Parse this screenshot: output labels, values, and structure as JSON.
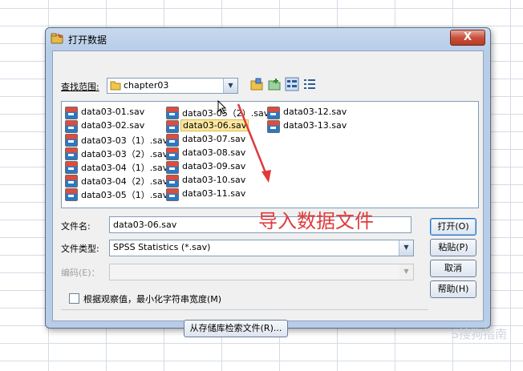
{
  "dialog": {
    "title": "打开数据",
    "close_label": "X",
    "look_in_label": "查找范围:",
    "look_in_value": "chapter03",
    "files": [
      {
        "name": "data03-01.sav",
        "selected": false
      },
      {
        "name": "data03-02.sav",
        "selected": false
      },
      {
        "name": "data03-03（1）.sav",
        "selected": false
      },
      {
        "name": "data03-03（2）.sav",
        "selected": false
      },
      {
        "name": "data03-04（1）.sav",
        "selected": false
      },
      {
        "name": "data03-04（2）.sav",
        "selected": false
      },
      {
        "name": "data03-05（1）.sav",
        "selected": false
      },
      {
        "name": "data03-05（2）.sav",
        "selected": false
      },
      {
        "name": "data03-06.sav",
        "selected": true
      },
      {
        "name": "data03-07.sav",
        "selected": false
      },
      {
        "name": "data03-08.sav",
        "selected": false
      },
      {
        "name": "data03-09.sav",
        "selected": false
      },
      {
        "name": "data03-10.sav",
        "selected": false
      },
      {
        "name": "data03-11.sav",
        "selected": false
      },
      {
        "name": "data03-12.sav",
        "selected": false
      },
      {
        "name": "data03-13.sav",
        "selected": false
      }
    ],
    "filename_label": "文件名:",
    "filename_value": "data03-06.sav",
    "filetype_label": "文件类型:",
    "filetype_value": "SPSS Statistics (*.sav)",
    "encoding_label": "编码(E)：",
    "checkbox_label": "根据观察值，最小化字符串宽度(M)",
    "retrieve_button": "从存储库检索文件(R)...",
    "buttons": {
      "open": "打开(O)",
      "paste": "粘贴(P)",
      "cancel": "取消",
      "help": "帮助(H)"
    }
  },
  "annotation": {
    "text": "导入数据文件",
    "color": "#e03a3a"
  },
  "watermark": "S搜狗指南"
}
